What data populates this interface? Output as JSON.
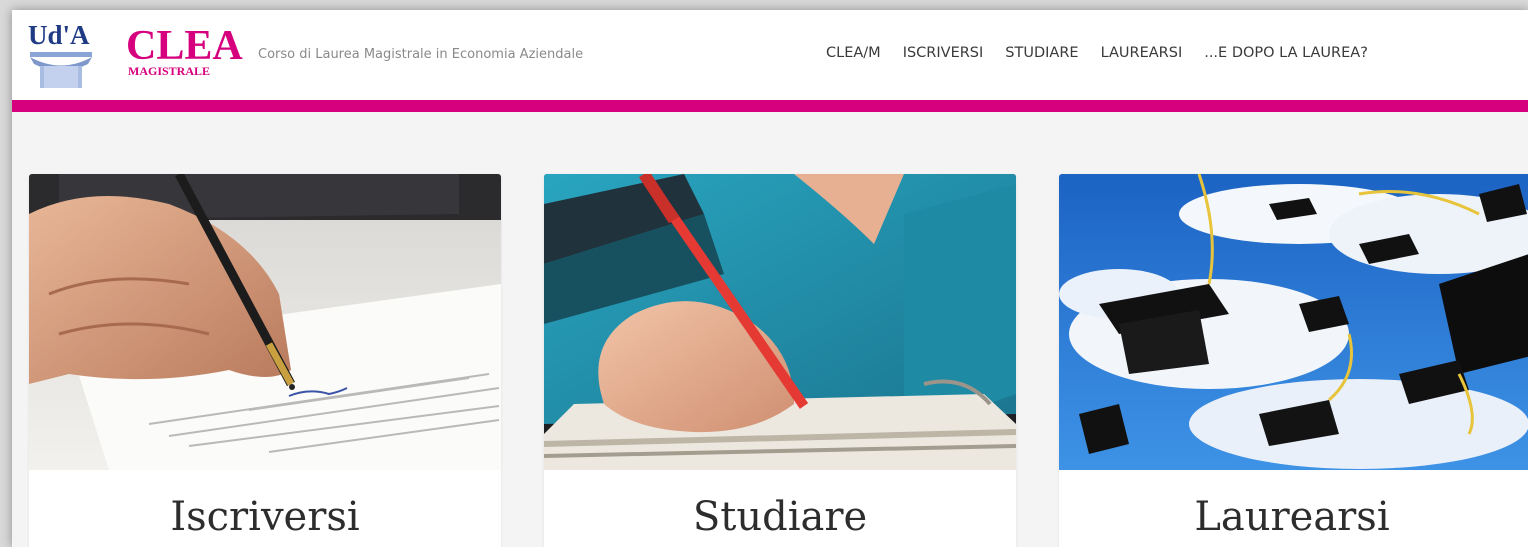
{
  "header": {
    "logo_uda": "Ud'A",
    "logo_clea": "CLEA",
    "logo_clea_sub": "MAGISTRALE",
    "subtitle": "Corso di Laurea Magistrale in Economia Aziendale"
  },
  "nav": {
    "items": [
      {
        "label": "CLEA/M"
      },
      {
        "label": "ISCRIVERSI"
      },
      {
        "label": "STUDIARE"
      },
      {
        "label": "LAUREARSI"
      },
      {
        "label": "...E DOPO LA LAUREA?"
      }
    ]
  },
  "cards": [
    {
      "title": "Iscriversi",
      "image": "hand-signing-document"
    },
    {
      "title": "Studiare",
      "image": "student-writing-notebook"
    },
    {
      "title": "Laurearsi",
      "image": "graduation-caps-sky"
    }
  ],
  "colors": {
    "accent": "#d6007e",
    "logo_blue": "#1f3b84",
    "sky": "#2f7fd8"
  }
}
